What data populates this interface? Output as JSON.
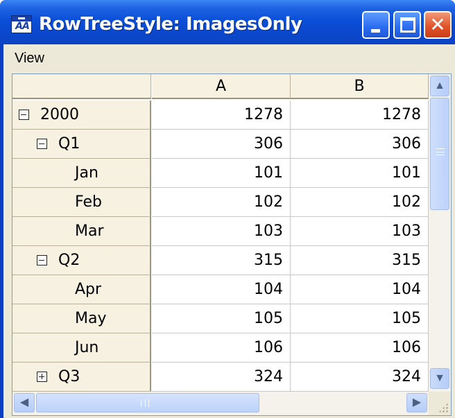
{
  "window": {
    "title": "RowTreeStyle: ImagesOnly",
    "icon": "app-icon"
  },
  "menu": {
    "items": [
      {
        "label": "View"
      }
    ]
  },
  "grid": {
    "columns": [
      {
        "label": "A"
      },
      {
        "label": "B"
      }
    ],
    "rows": [
      {
        "label": "2000",
        "level": 0,
        "expander": "minus",
        "a": "1278",
        "b": "1278"
      },
      {
        "label": "Q1",
        "level": 1,
        "expander": "minus",
        "a": "306",
        "b": "306"
      },
      {
        "label": "Jan",
        "level": 2,
        "expander": "none",
        "a": "101",
        "b": "101"
      },
      {
        "label": "Feb",
        "level": 2,
        "expander": "none",
        "a": "102",
        "b": "102"
      },
      {
        "label": "Mar",
        "level": 2,
        "expander": "none",
        "a": "103",
        "b": "103"
      },
      {
        "label": "Q2",
        "level": 1,
        "expander": "minus",
        "a": "315",
        "b": "315"
      },
      {
        "label": "Apr",
        "level": 2,
        "expander": "none",
        "a": "104",
        "b": "104"
      },
      {
        "label": "May",
        "level": 2,
        "expander": "none",
        "a": "105",
        "b": "105"
      },
      {
        "label": "Jun",
        "level": 2,
        "expander": "none",
        "a": "106",
        "b": "106"
      },
      {
        "label": "Q3",
        "level": 1,
        "expander": "plus",
        "a": "324",
        "b": "324"
      }
    ]
  },
  "colors": {
    "titlebar": "#0a47cc",
    "header_bg": "#f7f1e1",
    "chrome": "#ece9d8",
    "close_button": "#e2552c"
  },
  "icons": {
    "minimize": "minimize-icon",
    "maximize": "maximize-icon",
    "close": "close-icon",
    "collapse": "minus-box-icon",
    "expand": "plus-box-icon",
    "scroll_up": "arrow-up-icon",
    "scroll_down": "arrow-down-icon",
    "scroll_left": "arrow-left-icon",
    "scroll_right": "arrow-right-icon"
  }
}
